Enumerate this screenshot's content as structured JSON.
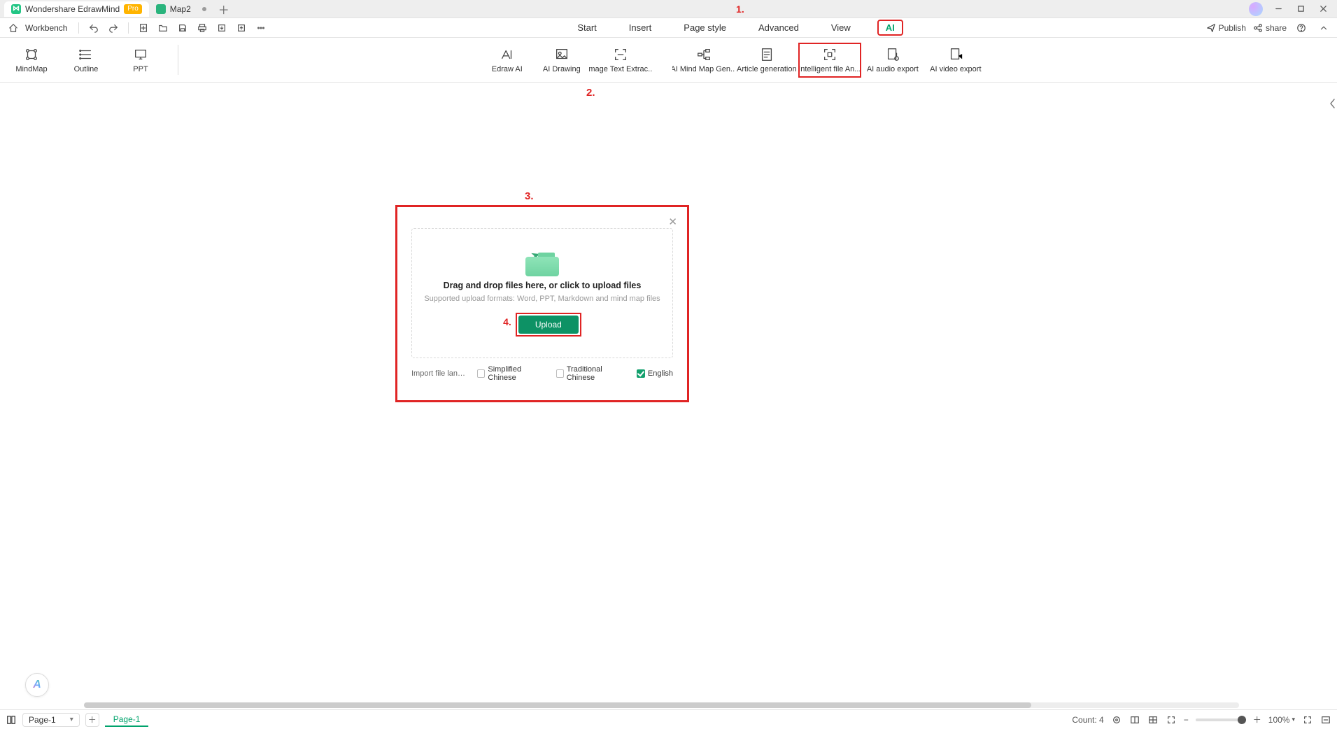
{
  "titlebar": {
    "app_name": "Wondershare EdrawMind",
    "pro_badge": "Pro",
    "doc_tab": "Map2"
  },
  "callouts": {
    "one": "1.",
    "two": "2.",
    "three": "3.",
    "four": "4."
  },
  "workbench_label": "Workbench",
  "menu": {
    "items": [
      "Start",
      "Insert",
      "Page style",
      "Advanced",
      "View",
      "AI"
    ],
    "active_index": 5
  },
  "top_right": {
    "publish": "Publish",
    "share": "share"
  },
  "ribbon": {
    "views": [
      "MindMap",
      "Outline",
      "PPT"
    ],
    "ai_tools": [
      "Edraw AI",
      "AI Drawing",
      "Image Text Extrac...",
      "AI Mind Map Gen...",
      "Article generation",
      "Intelligent file An...",
      "AI audio export",
      "AI video export"
    ],
    "highlight_index": 5
  },
  "dialog": {
    "drop_title": "Drag and drop files here, or click to upload files",
    "drop_sub": "Supported upload formats: Word, PPT, Markdown and mind map files",
    "upload": "Upload",
    "lang_label": "Import file langu...",
    "opts": {
      "simplified": "Simplified Chinese",
      "traditional": "Traditional Chinese",
      "english": "English"
    },
    "checked": "english"
  },
  "status": {
    "page_select": "Page-1",
    "page_tab": "Page-1",
    "count_label": "Count: 4",
    "zoom_value": "100%"
  }
}
